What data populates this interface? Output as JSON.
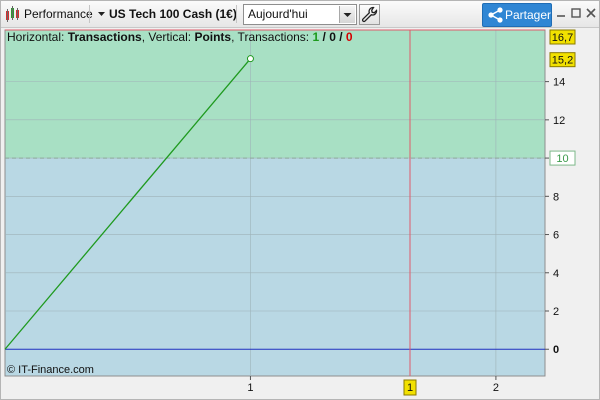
{
  "toolbar": {
    "performance_label": "Performance",
    "instrument_label": "US Tech 100 Cash (1€)",
    "period_value": "Aujourd'hui",
    "share_label": "Partager"
  },
  "header": {
    "horizontal_prefix": "Horizontal:",
    "horizontal_value": "Transactions",
    "vertical_prefix": ", Vertical:",
    "vertical_value": "Points",
    "transactions_prefix": ", Transactions:",
    "wins": "1",
    "neutral": "0",
    "losses": "0",
    "slash": " / "
  },
  "footer": {
    "copyright": "© IT-Finance.com"
  },
  "colors": {
    "profit_zone": "#a8e0c4",
    "loss_zone": "#b9d8e4",
    "equity_line": "#1f9a1f",
    "zero_line": "#2030c0",
    "cursor_line": "#e05a6a",
    "badge_fill": "#f2e100",
    "share_button": "#2f86d4"
  },
  "chart_data": {
    "type": "line",
    "title": "",
    "xlabel": "Transactions",
    "ylabel": "Points",
    "x_ticks": [
      "1",
      "2"
    ],
    "y_ticks": [
      "0",
      "2",
      "4",
      "6",
      "8",
      "10",
      "12",
      "14"
    ],
    "xlim": [
      0,
      2.2
    ],
    "ylim": [
      -1.4,
      16.7
    ],
    "series": [
      {
        "x": [
          0,
          1
        ],
        "y": [
          0,
          15.2
        ]
      }
    ],
    "max_value_label": "16,7",
    "last_value_label": "15,2",
    "threshold_value": 10,
    "threshold_label": "10",
    "cursor_x": 1.65,
    "cursor_label": "1",
    "grid": true,
    "profit_zone_min": 10
  }
}
